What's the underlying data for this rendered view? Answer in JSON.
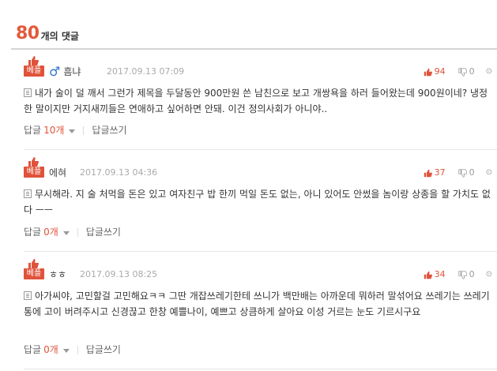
{
  "header": {
    "count": "80",
    "label": "개의 댓글"
  },
  "best_label": "베플",
  "comments": [
    {
      "nick": "흠냐",
      "gender_icon": "♂",
      "date": "2017.09.13 07:09",
      "up": "94",
      "down": "0",
      "text": "내가 술이 덜 깨서 그런가 제목을 두달동안 900만원 쓴 남친으로 보고 개쌍욕을 하러 들어왔는데 900원이네? 냉정한 말이지만 거지새끼들은 연애하고 싶어하면 안돼. 이건 정의사회가 아니야..",
      "reply_label": "답글",
      "reply_count": "10개",
      "write_label": "답글쓰기"
    },
    {
      "nick": "에혀",
      "date": "2017.09.13 04:36",
      "up": "37",
      "down": "0",
      "text": "무시해라. 지 술 처먹을 돈은 있고 여자친구 밥 한끼 먹일 돈도 없는, 아니 있어도 안썼을 놈이랑 상종을 할 가치도 없다 ㅡㅡ",
      "reply_label": "답글",
      "reply_count": "0개",
      "write_label": "답글쓰기"
    },
    {
      "nick": "ㅎㅎ",
      "date": "2017.09.13 08:25",
      "up": "34",
      "down": "0",
      "text": "아가씨야, 고민할걸 고민해요ㅋㅋ 그딴 개잡쓰레기한테 쓰니가 백만배는 아까운데 뭐하러 말섞어요 쓰레기는 쓰레기통에 고이 버려주시고 신경끊고 한창 예쁠나이, 예쁘고 상큼하게 살아요 이성 거르는 눈도 기르시구요",
      "reply_label": "답글",
      "reply_count": "0개",
      "write_label": "답글쓰기"
    }
  ]
}
